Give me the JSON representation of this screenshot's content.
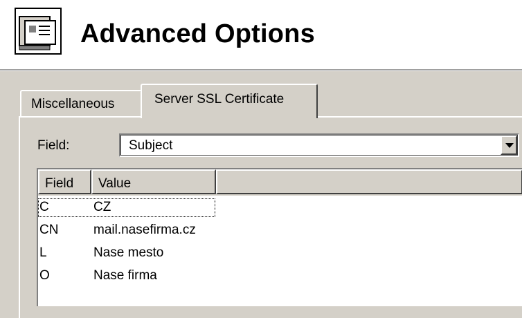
{
  "header": {
    "title": "Advanced Options",
    "icon": "server-options-icon"
  },
  "tabs": [
    {
      "label": "Miscellaneous",
      "active": false
    },
    {
      "label": "Server SSL Certificate",
      "active": true
    }
  ],
  "form": {
    "field_label": "Field:",
    "field_value": "Subject"
  },
  "list": {
    "columns": [
      "Field",
      "Value"
    ],
    "rows": [
      {
        "field": "C",
        "value": "CZ",
        "focused": true
      },
      {
        "field": "CN",
        "value": "mail.nasefirma.cz",
        "focused": false
      },
      {
        "field": "L",
        "value": "Nase mesto",
        "focused": false
      },
      {
        "field": "O",
        "value": "Nase firma",
        "focused": false
      }
    ]
  },
  "colors": {
    "dialog_bg": "#d4d0c8",
    "header_bg": "#ffffff"
  }
}
